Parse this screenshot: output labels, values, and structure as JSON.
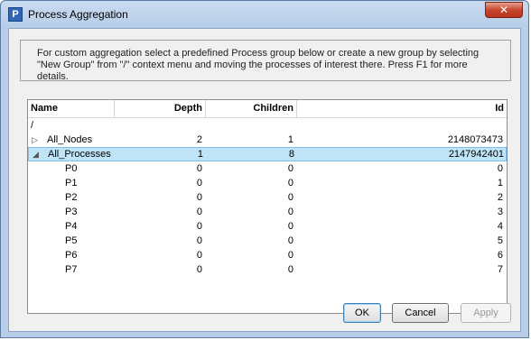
{
  "window": {
    "title": "Process Aggregation",
    "app_icon": "P",
    "close_glyph": "✕"
  },
  "info": {
    "text": "For custom aggregation select a predefined Process group below or create a new group by selecting \"New Group\" from \"/\" context menu and moving the processes of interest there. Press F1 for more details."
  },
  "tree": {
    "columns": [
      "Name",
      "Depth",
      "Children",
      "Id"
    ],
    "root": {
      "name": "/"
    },
    "groups": [
      {
        "name": "All_Nodes",
        "depth": "2",
        "children": "1",
        "id": "2148073473",
        "expander": "▷"
      },
      {
        "name": "All_Processes",
        "depth": "1",
        "children": "8",
        "id": "2147942401",
        "expander": "◢"
      }
    ],
    "processes": [
      {
        "name": "P0",
        "depth": "0",
        "children": "0",
        "id": "0"
      },
      {
        "name": "P1",
        "depth": "0",
        "children": "0",
        "id": "1"
      },
      {
        "name": "P2",
        "depth": "0",
        "children": "0",
        "id": "2"
      },
      {
        "name": "P3",
        "depth": "0",
        "children": "0",
        "id": "3"
      },
      {
        "name": "P4",
        "depth": "0",
        "children": "0",
        "id": "4"
      },
      {
        "name": "P5",
        "depth": "0",
        "children": "0",
        "id": "5"
      },
      {
        "name": "P6",
        "depth": "0",
        "children": "0",
        "id": "6"
      },
      {
        "name": "P7",
        "depth": "0",
        "children": "0",
        "id": "7"
      }
    ]
  },
  "buttons": {
    "ok": "OK",
    "cancel": "Cancel",
    "apply": "Apply"
  },
  "colors": {
    "selection": "#bfe4f8",
    "title_bar": "#b7cde8"
  }
}
